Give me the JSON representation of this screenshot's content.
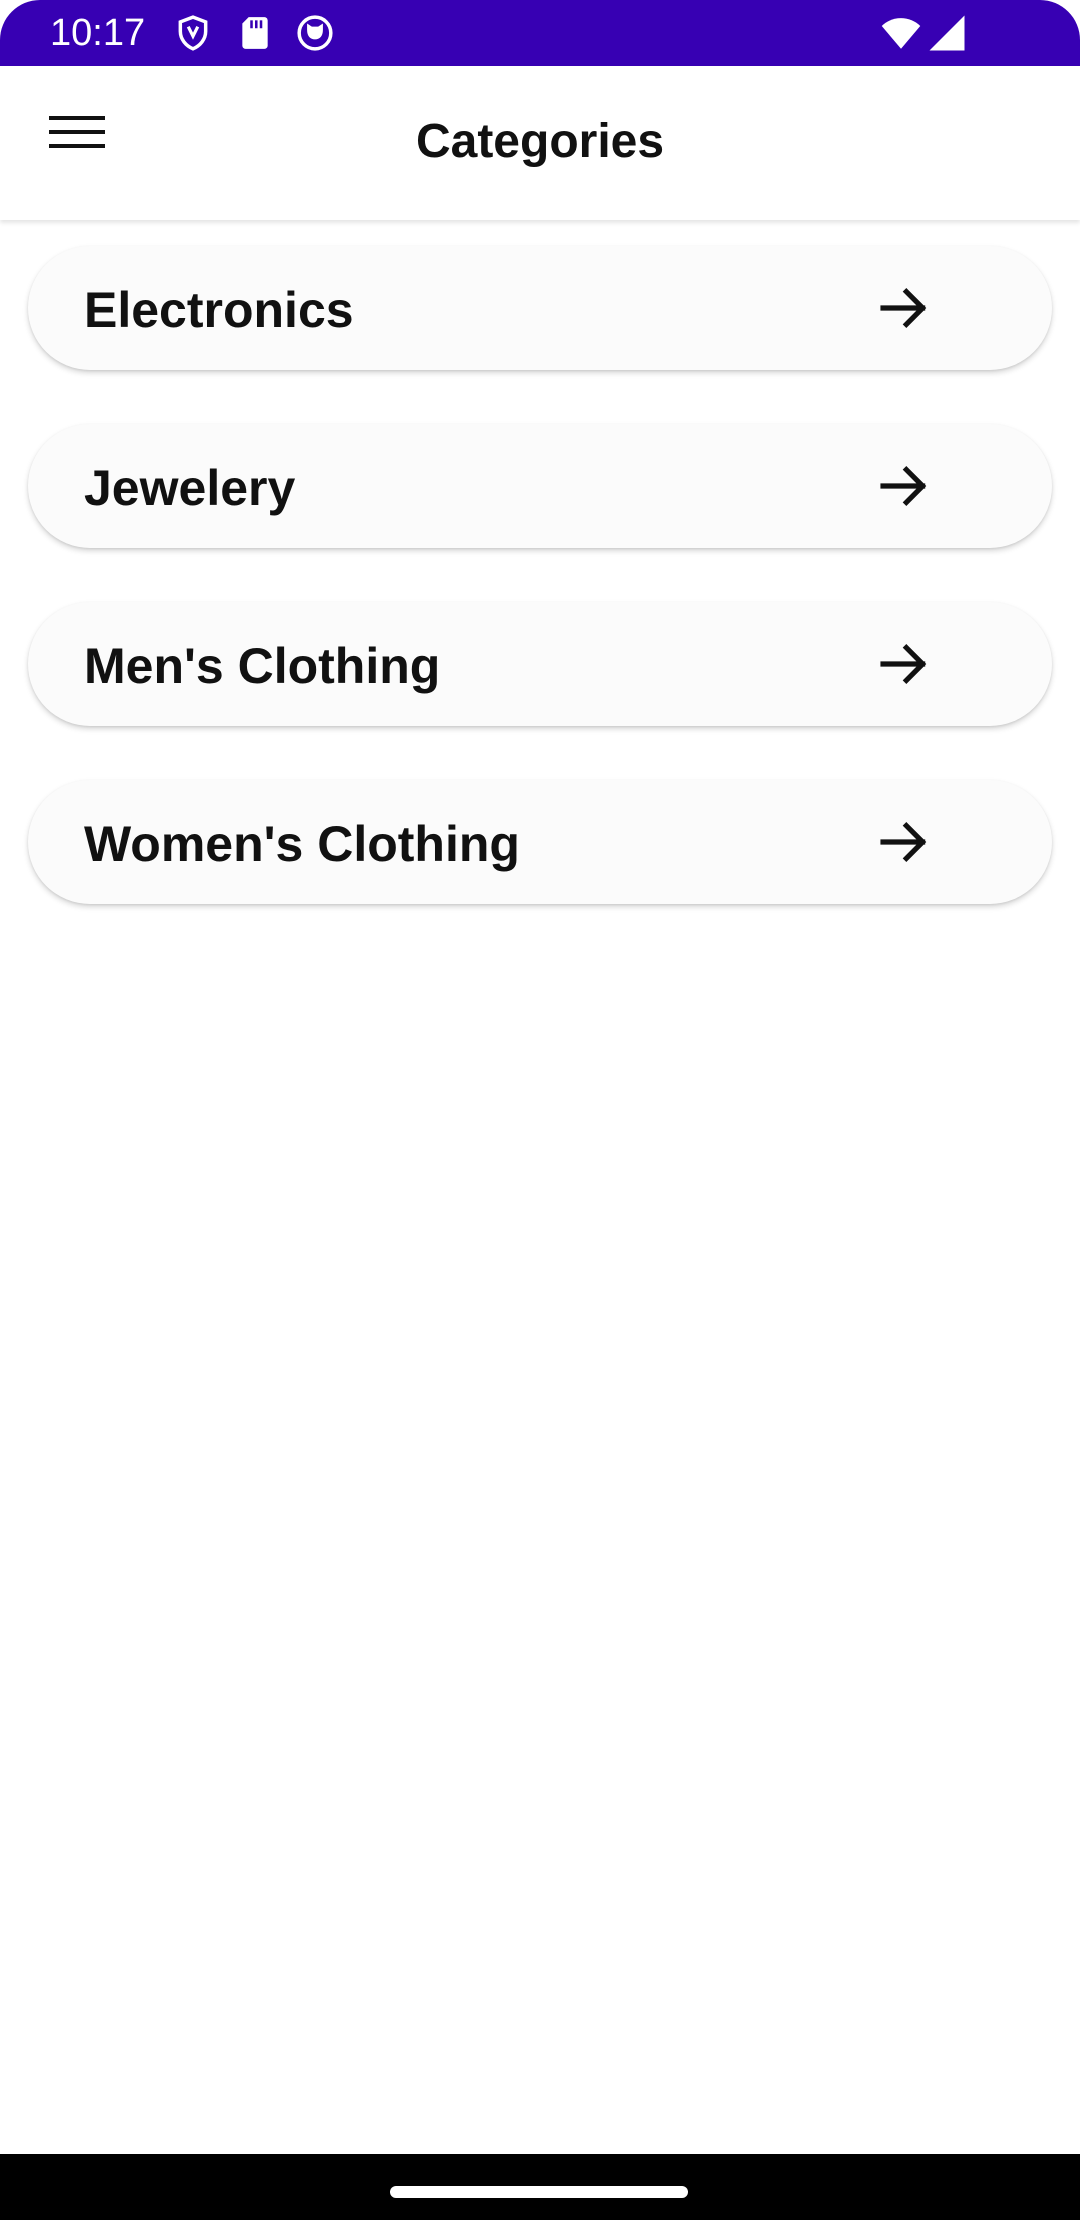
{
  "status_bar": {
    "time": "10:17",
    "background_color": "#3700b3",
    "left_icons": [
      "shield-icon",
      "sd-card-icon",
      "cat-face-icon"
    ],
    "right_icons": [
      "wifi-icon",
      "signal-icon"
    ]
  },
  "app_bar": {
    "title": "Categories",
    "menu_icon": "hamburger-menu-icon"
  },
  "categories": [
    {
      "label": "Electronics",
      "icon": "arrow-right-icon"
    },
    {
      "label": "Jewelery",
      "icon": "arrow-right-icon"
    },
    {
      "label": "Men's Clothing",
      "icon": "arrow-right-icon"
    },
    {
      "label": "Women's Clothing",
      "icon": "arrow-right-icon"
    }
  ],
  "nav_bar": {
    "handle": "home-gesture-handle"
  }
}
